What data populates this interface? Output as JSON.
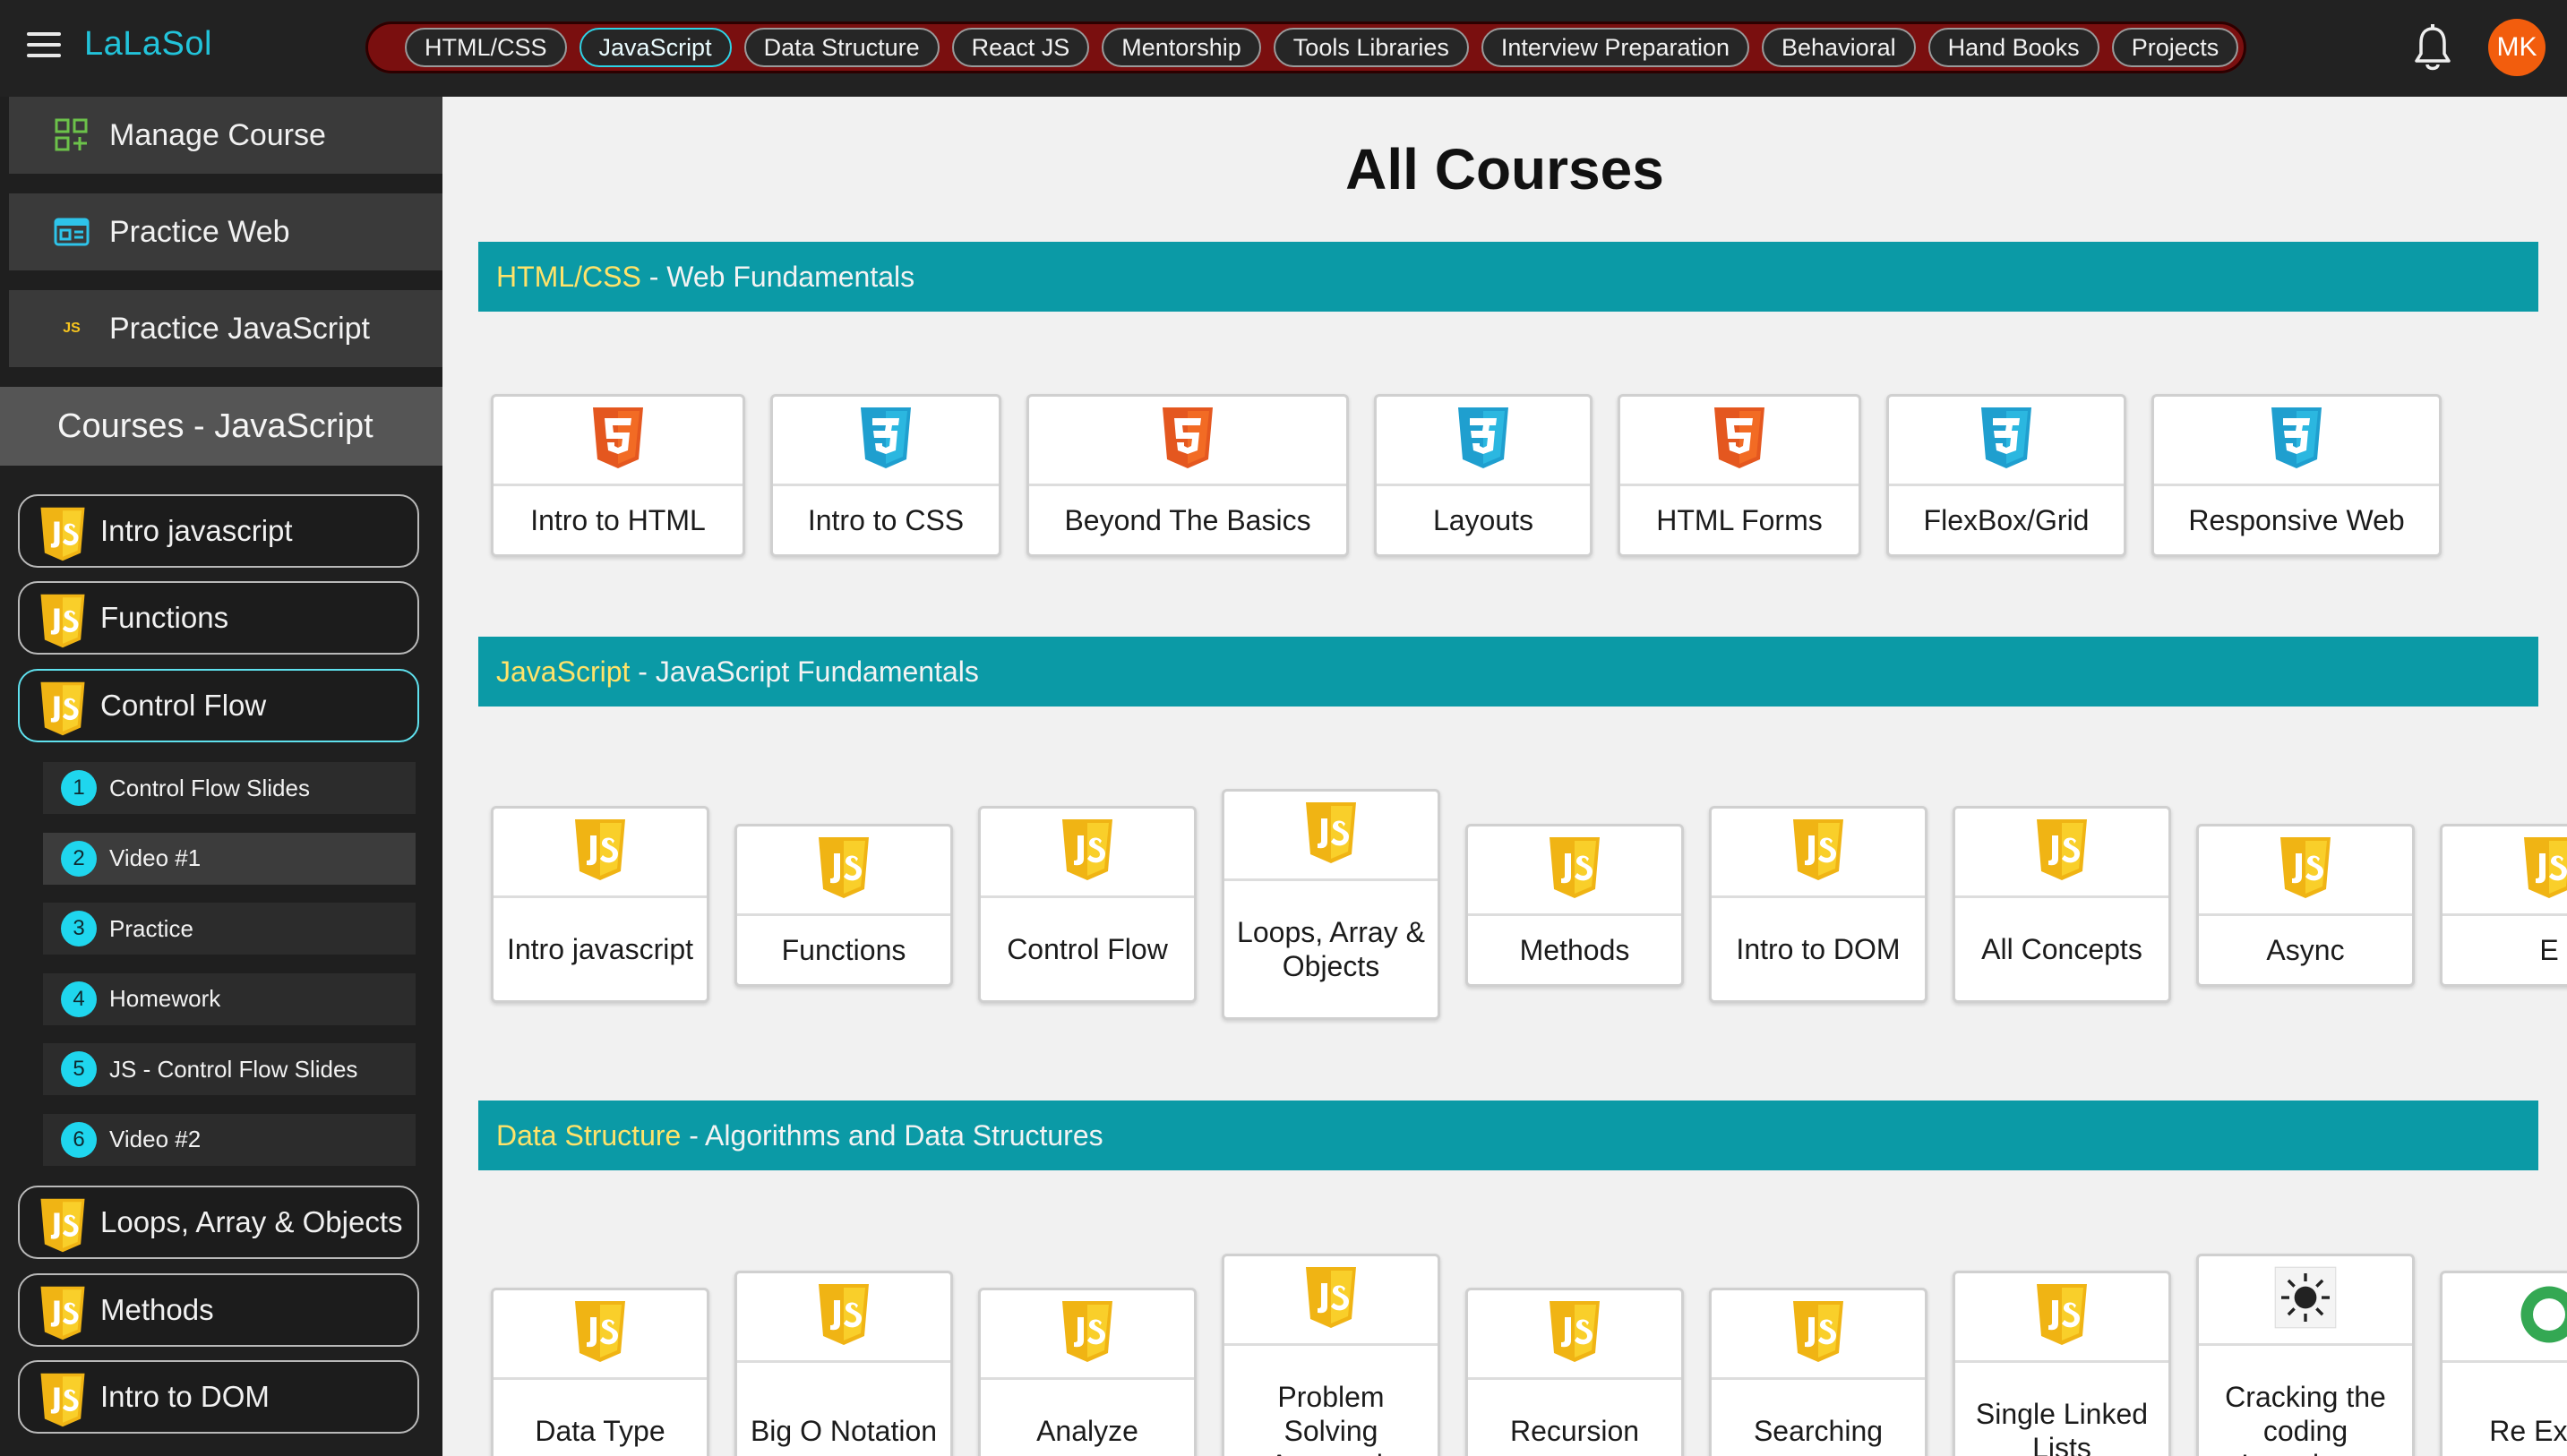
{
  "app": {
    "brand": "LaLaSol",
    "avatar_initials": "MK"
  },
  "nav": [
    {
      "label": "HTML/CSS",
      "active": false
    },
    {
      "label": "JavaScript",
      "active": true
    },
    {
      "label": "Data Structure",
      "active": false
    },
    {
      "label": "React JS",
      "active": false
    },
    {
      "label": "Mentorship",
      "active": false
    },
    {
      "label": "Tools Libraries",
      "active": false
    },
    {
      "label": "Interview Preparation",
      "active": false
    },
    {
      "label": "Behavioral",
      "active": false
    },
    {
      "label": "Hand Books",
      "active": false
    },
    {
      "label": "Projects",
      "active": false
    }
  ],
  "sidebar": {
    "top": [
      {
        "label": "Manage Course",
        "icon": "grid-plus-icon"
      },
      {
        "label": "Practice Web",
        "icon": "browser-icon"
      },
      {
        "label": "Practice JavaScript",
        "icon": "js-text-icon"
      }
    ],
    "courses_header": "Courses - JavaScript",
    "lessons_before": [
      {
        "label": "Intro javascript"
      },
      {
        "label": "Functions"
      },
      {
        "label": "Control Flow"
      }
    ],
    "subitems": [
      {
        "num": "1",
        "label": "Control Flow Slides"
      },
      {
        "num": "2",
        "label": "Video #1"
      },
      {
        "num": "3",
        "label": "Practice"
      },
      {
        "num": "4",
        "label": "Homework"
      },
      {
        "num": "5",
        "label": "JS - Control Flow Slides"
      },
      {
        "num": "6",
        "label": "Video #2"
      }
    ],
    "lessons_after": [
      {
        "label": "Loops, Array & Objects"
      },
      {
        "label": "Methods"
      },
      {
        "label": "Intro to DOM"
      }
    ]
  },
  "main": {
    "title": "All Courses",
    "sections": [
      {
        "name": "HTML/CSS",
        "subtitle": " - Web Fundamentals",
        "cards": [
          {
            "label": "Intro to HTML",
            "icon": "html5-icon"
          },
          {
            "label": "Intro to CSS",
            "icon": "css3-icon"
          },
          {
            "label": "Beyond The Basics",
            "icon": "html5-icon"
          },
          {
            "label": "Layouts",
            "icon": "css3-icon"
          },
          {
            "label": "HTML Forms",
            "icon": "html5-icon"
          },
          {
            "label": "FlexBox/Grid",
            "icon": "css3-icon"
          },
          {
            "label": "Responsive Web",
            "icon": "css3-icon"
          }
        ]
      },
      {
        "name": "JavaScript",
        "subtitle": " - JavaScript Fundamentals",
        "cards": [
          {
            "label": "Intro javascript",
            "icon": "js-shield-icon"
          },
          {
            "label": "Functions",
            "icon": "js-shield-icon"
          },
          {
            "label": "Control Flow",
            "icon": "js-shield-icon"
          },
          {
            "label": "Loops, Array & Objects",
            "icon": "js-shield-icon"
          },
          {
            "label": "Methods",
            "icon": "js-shield-icon"
          },
          {
            "label": "Intro to DOM",
            "icon": "js-shield-icon"
          },
          {
            "label": "All Concepts",
            "icon": "js-shield-icon"
          },
          {
            "label": "Async",
            "icon": "js-shield-icon"
          },
          {
            "label": "E",
            "icon": "js-shield-icon"
          }
        ]
      },
      {
        "name": "Data Structure",
        "subtitle": " - Algorithms and Data Structures",
        "cards": [
          {
            "label": "Data Type",
            "icon": "js-shield-icon"
          },
          {
            "label": "Big O Notation",
            "icon": "js-shield-icon"
          },
          {
            "label": "Analyze",
            "icon": "js-shield-icon"
          },
          {
            "label": "Problem Solving Approach",
            "icon": "js-shield-icon"
          },
          {
            "label": "Recursion",
            "icon": "js-shield-icon"
          },
          {
            "label": "Searching",
            "icon": "js-shield-icon"
          },
          {
            "label": "Single Linked Lists",
            "icon": "js-shield-icon"
          },
          {
            "label": "Cracking the coding Interviews",
            "icon": "sun-chip-icon"
          },
          {
            "label": "Re Expre",
            "icon": "green-circle-icon"
          }
        ]
      }
    ]
  },
  "colors": {
    "accent": "#22c3da",
    "section_bar": "#0b9aa6",
    "nav_bg": "#7a0f0f",
    "avatar": "#f25d0d",
    "js_yellow": "#f7c51e",
    "html_orange": "#f26b24",
    "css_cyan": "#2bb7e0"
  }
}
